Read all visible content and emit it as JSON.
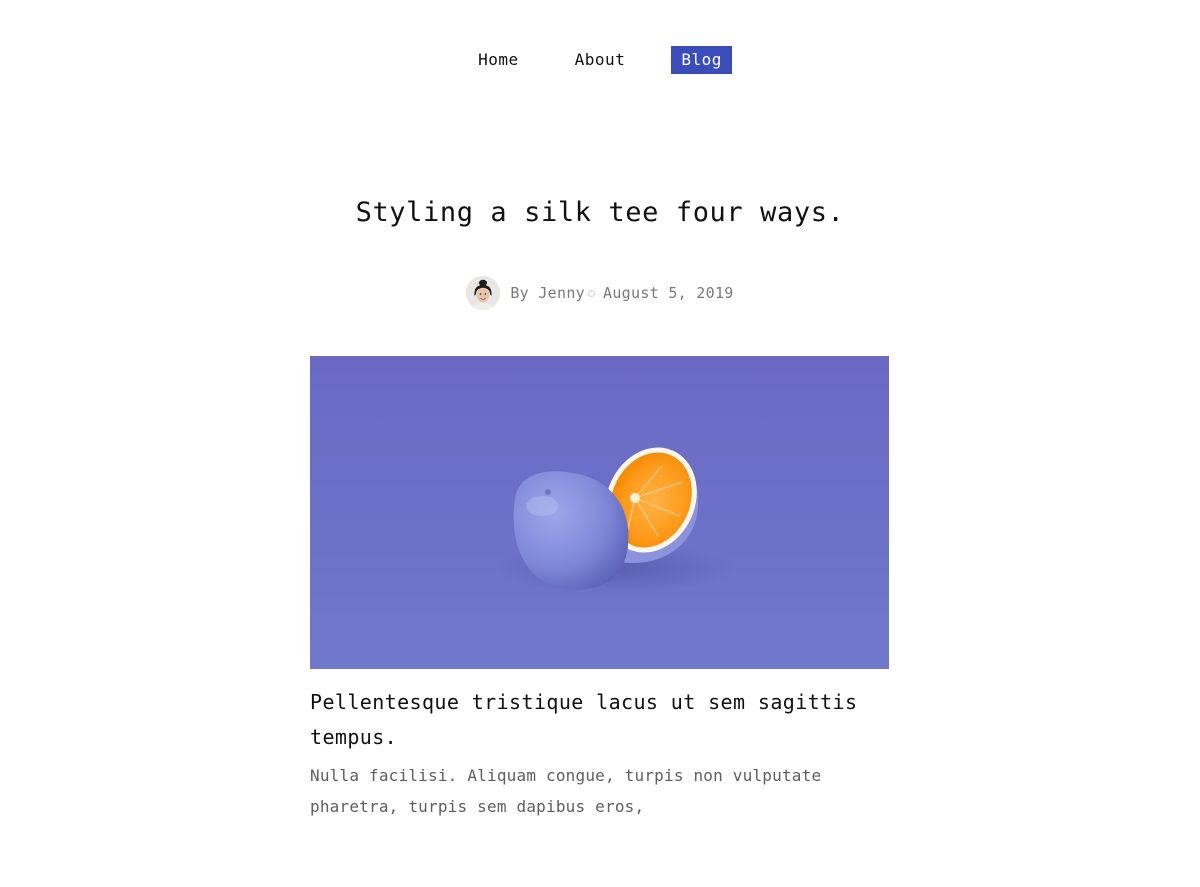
{
  "nav": {
    "items": [
      {
        "label": "Home",
        "active": false
      },
      {
        "label": "About",
        "active": false
      },
      {
        "label": "Blog",
        "active": true
      }
    ],
    "active_color": "#3b4dba"
  },
  "post": {
    "title": "Styling a silk tee four ways.",
    "author": "By Jenny",
    "date": "August 5, 2019",
    "hero_image": "orange-half-painted-purple",
    "heading": "Pellentesque tristique lacus ut sem sagittis tempus.",
    "excerpt": "Nulla facilisi. Aliquam congue, turpis non vulputate pharetra, turpis sem dapibus eros,"
  },
  "colors": {
    "hero_background": "#6b6ec6",
    "text": "#111111",
    "muted": "#7a7a7a"
  }
}
